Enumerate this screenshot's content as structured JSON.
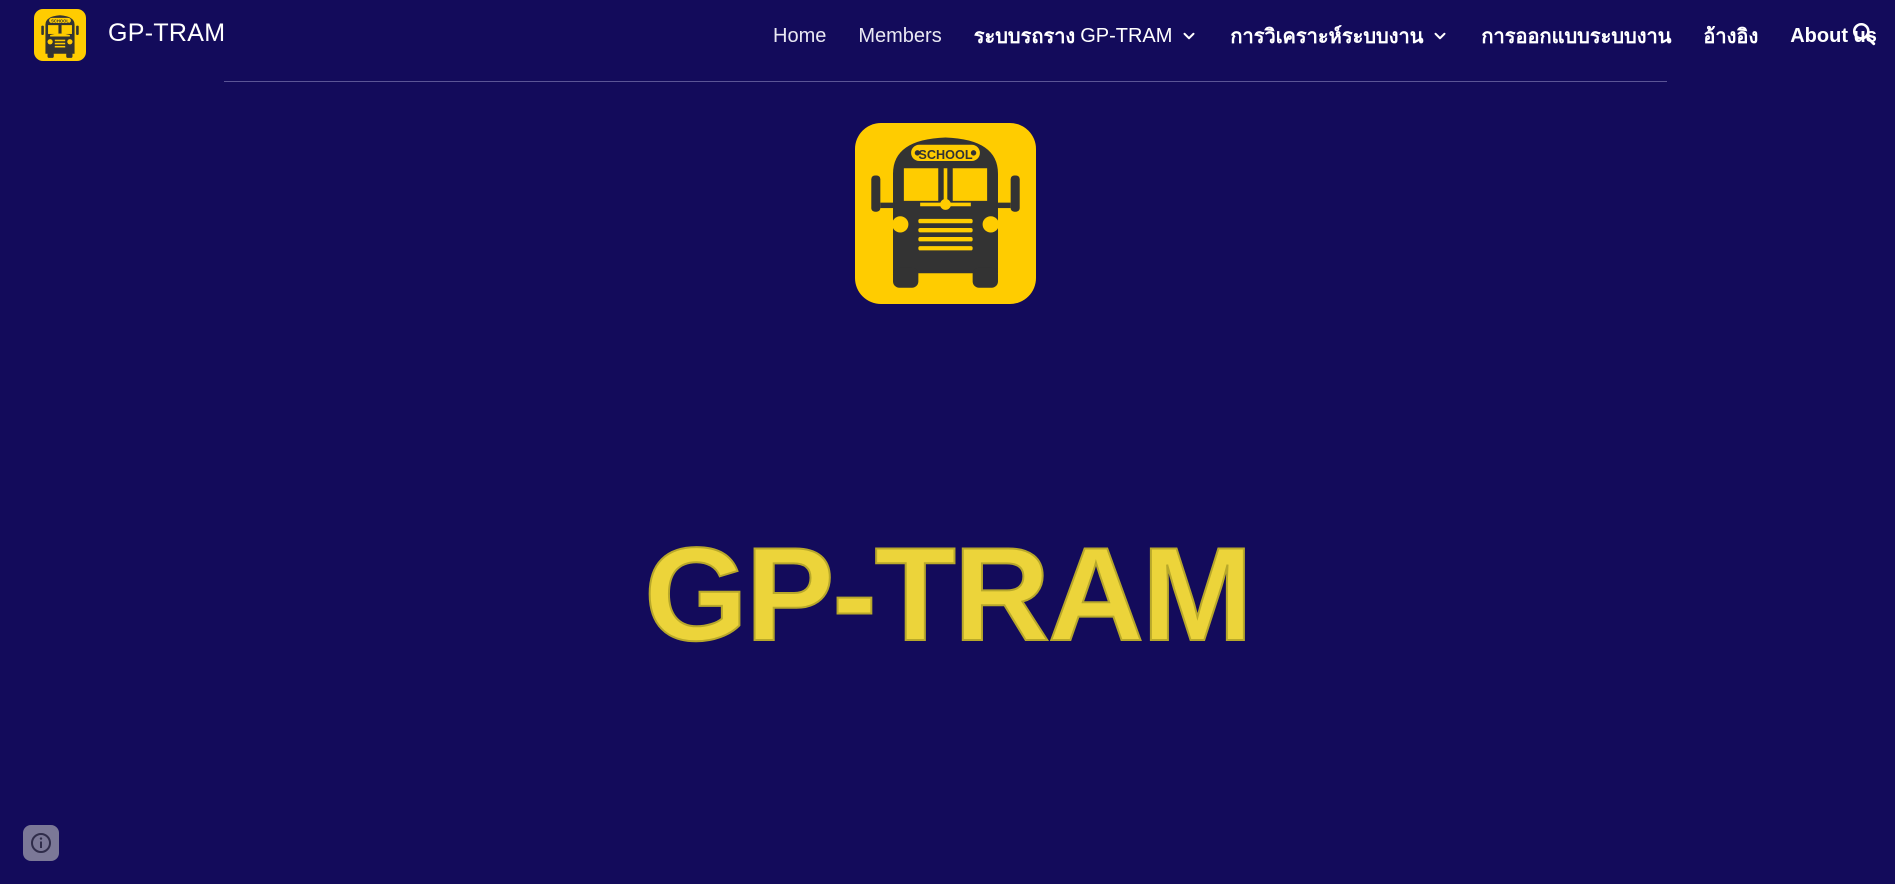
{
  "site": {
    "title": "GP-TRAM",
    "logo_icon": "school-bus-icon",
    "logo_text": "SCHOOL"
  },
  "nav": {
    "items": [
      {
        "label": "Home"
      },
      {
        "label": "Members"
      },
      {
        "label_thai": "ระบบรถราง",
        "label_latin": "GP-TRAM",
        "has_dropdown": true
      },
      {
        "label": "การวิเคราะห์ระบบงาน",
        "has_dropdown": true
      },
      {
        "label": "การออกแบบระบบงาน"
      },
      {
        "label": "อ้างอิง"
      },
      {
        "label": "About us"
      }
    ],
    "search_icon": "search-icon",
    "dropdown_icon": "chevron-down-icon"
  },
  "main": {
    "hero_title": "GP-TRAM",
    "hero_icon": "school-bus-icon"
  },
  "footer": {
    "info_icon": "info-icon"
  },
  "colors": {
    "background": "#130b5b",
    "accent": "#ffcc00",
    "title_fill": "#ecd43a",
    "bus": "#333333"
  }
}
